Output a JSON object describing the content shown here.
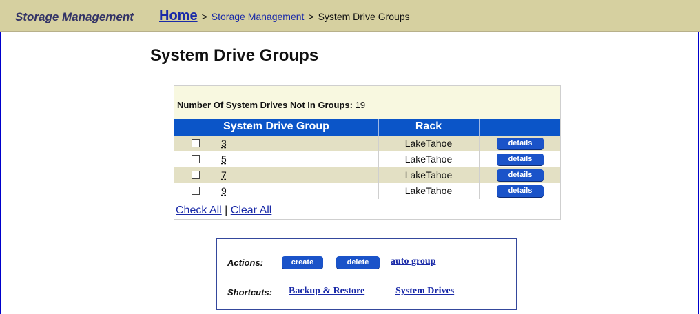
{
  "header": {
    "brand": "Storage Management",
    "breadcrumb": {
      "home": "Home",
      "sep1": ">",
      "middle": "Storage Management",
      "sep2": ">",
      "current": "System Drive Groups"
    }
  },
  "page_title": "System Drive Groups",
  "summary": {
    "label": "Number Of System Drives Not In Groups:",
    "value": "19"
  },
  "table": {
    "headers": [
      "System Drive Group",
      "Rack",
      ""
    ],
    "rows": [
      {
        "group": "3",
        "rack": "LakeTahoe",
        "action": "details"
      },
      {
        "group": "5",
        "rack": "LakeTahoe",
        "action": "details"
      },
      {
        "group": "7",
        "rack": "LakeTahoe",
        "action": "details"
      },
      {
        "group": "9",
        "rack": "LakeTahoe",
        "action": "details"
      }
    ]
  },
  "check_links": {
    "check_all": "Check All",
    "separator": "|",
    "clear_all": "Clear All"
  },
  "actions": {
    "label": "Actions:",
    "create": "create",
    "delete": "delete",
    "auto_group": "auto group"
  },
  "shortcuts": {
    "label": "Shortcuts:",
    "backup": "Backup & Restore",
    "system_drives": "System Drives"
  },
  "colors": {
    "header_bg": "#d6d0a0",
    "table_header_bg": "#0b55c8",
    "row_alt_bg": "#e3e0c4",
    "button_bg": "#1a53c9",
    "link": "#1a2aa8"
  }
}
